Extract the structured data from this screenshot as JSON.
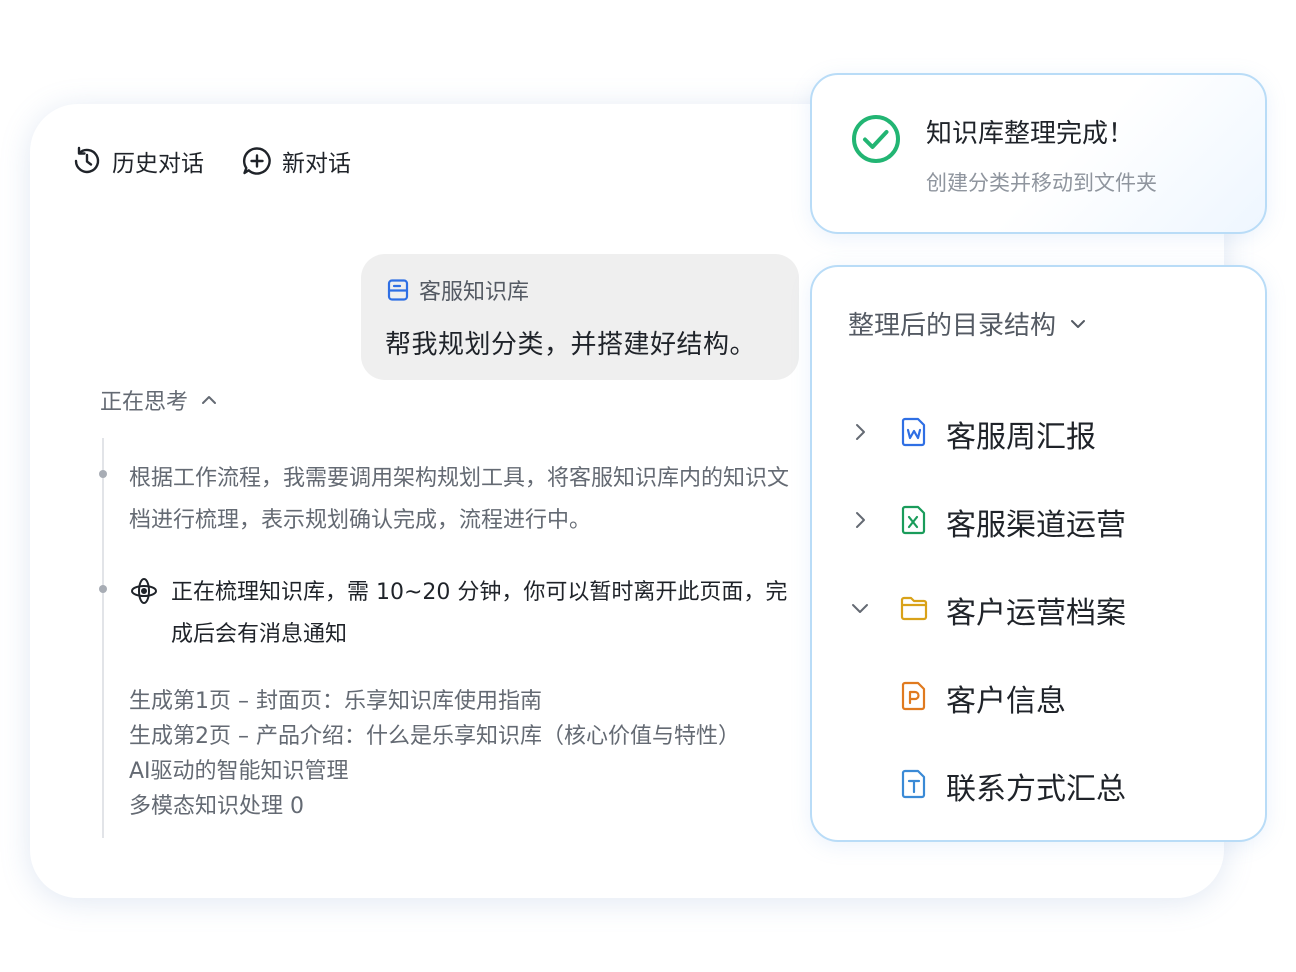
{
  "toolbar": {
    "history_label": "历史对话",
    "new_chat_label": "新对话"
  },
  "user_message": {
    "source_label": "客服知识库",
    "text": "帮我规划分类，并搭建好结构。"
  },
  "thinking": {
    "toggle_label": "正在思考",
    "step_text": "根据工作流程，我需要调用架构规划工具，将客服知识库内的知识文档进行梳理，表示规划确认完成，流程进行中。",
    "status_text": "正在梳理知识库，需 10~20 分钟，你可以暂时离开此页面，完成后会有消息通知",
    "progress_lines": [
      "生成第1页 – 封面页：乐享知识库使用指南",
      "生成第2页 – 产品介绍：什么是乐享知识库（核心价值与特性）",
      "AI驱动的智能知识管理",
      "多模态知识处理 0"
    ]
  },
  "success": {
    "title": "知识库整理完成！",
    "subtitle": "创建分类并移动到文件夹",
    "accent": "#22b573"
  },
  "directory": {
    "header": "整理后的目录结构",
    "items": [
      {
        "label": "客服周汇报",
        "icon": "word-doc-icon",
        "caret": "right"
      },
      {
        "label": "客服渠道运营",
        "icon": "excel-doc-icon",
        "caret": "right"
      },
      {
        "label": "客户运营档案",
        "icon": "folder-icon",
        "caret": "down"
      },
      {
        "label": "客户信息",
        "icon": "ppt-doc-icon",
        "caret": "none"
      },
      {
        "label": "联系方式汇总",
        "icon": "text-doc-icon",
        "caret": "none"
      }
    ]
  }
}
